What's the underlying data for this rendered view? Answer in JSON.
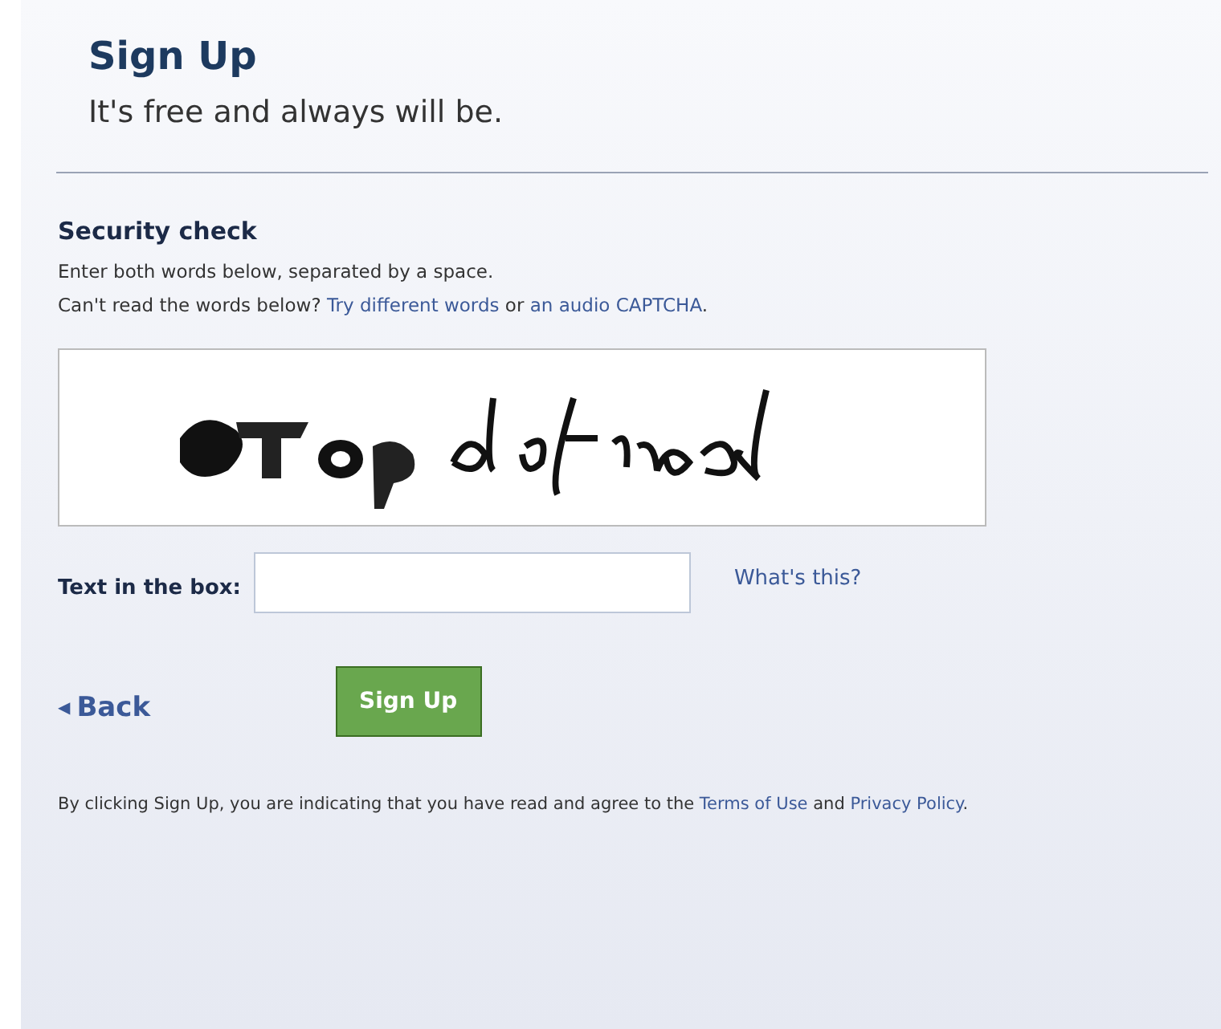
{
  "header": {
    "title": "Sign Up",
    "subtitle": "It's free and always will be."
  },
  "security": {
    "heading": "Security check",
    "instruction": "Enter both words below, separated by a space.",
    "help": [
      {
        "kind": "text",
        "text": "Can't read the words below? "
      },
      {
        "kind": "link",
        "text": "Try different words"
      },
      {
        "kind": "text",
        "text": " or "
      },
      {
        "kind": "link",
        "text": "an audio CAPTCHA"
      },
      {
        "kind": "text",
        "text": "."
      }
    ],
    "field_label": "Text in the box:",
    "help_link": "What's this?"
  },
  "actions": {
    "back": "Back",
    "back_icon": "◀",
    "submit": "Sign Up"
  },
  "legal": [
    {
      "kind": "text",
      "text": "By clicking Sign Up, you are indicating that you have read and agree to the "
    },
    {
      "kind": "link",
      "text": "Terms of Use"
    },
    {
      "kind": "text",
      "text": " and "
    },
    {
      "kind": "link",
      "text": "Privacy Policy"
    },
    {
      "kind": "text",
      "text": "."
    }
  ]
}
